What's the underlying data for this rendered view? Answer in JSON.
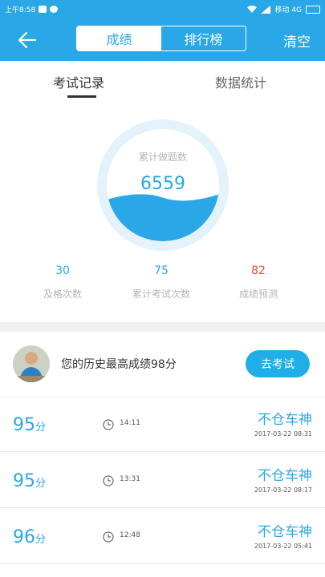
{
  "status": {
    "time": "上午8:58",
    "carrier": "移动 4G"
  },
  "header": {
    "back": "back",
    "tabs": [
      "成绩",
      "排行榜"
    ],
    "active_tab": 0,
    "clear": "清空"
  },
  "subtabs": [
    "考试记录",
    "数据统计"
  ],
  "gauge": {
    "label": "累计做题数",
    "value": "6559",
    "fill_fraction": 0.36
  },
  "stats": [
    {
      "value": "30",
      "label": "及格次数",
      "color": "#2aa7e6"
    },
    {
      "value": "75",
      "label": "累计考试次数",
      "color": "#2aa7e6"
    },
    {
      "value": "82",
      "label": "成绩预测",
      "color": "#e84c3d"
    }
  ],
  "best": {
    "text": "您的历史最高成绩98分",
    "button": "去考试"
  },
  "records": [
    {
      "score": "95",
      "unit": "分",
      "duration": "14:11",
      "title": "不仓车神",
      "date": "2017-03-22  08:31"
    },
    {
      "score": "95",
      "unit": "分",
      "duration": "13:31",
      "title": "不仓车神",
      "date": "2017-03-22  08:17"
    },
    {
      "score": "96",
      "unit": "分",
      "duration": "12:48",
      "title": "不仓车神",
      "date": "2017-03-22  05:41"
    }
  ],
  "colors": {
    "primary": "#2aa7e6",
    "accent_red": "#e84c3d"
  }
}
